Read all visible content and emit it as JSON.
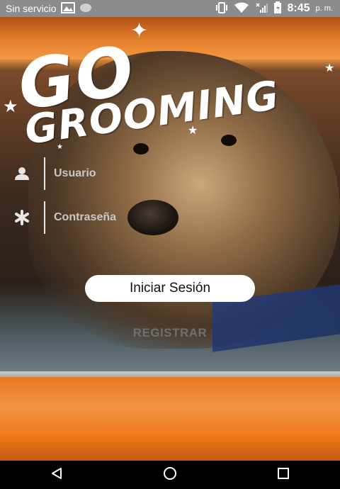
{
  "status_bar": {
    "carrier": "Sin servicio",
    "time": "8:45",
    "ampm": "p. m."
  },
  "logo": {
    "line1": "GO",
    "line2": "GROOMING"
  },
  "form": {
    "username_placeholder": "Usuario",
    "password_placeholder": "Contraseña",
    "login_label": "Iniciar Sesión",
    "register_label": "REGISTRAR"
  },
  "nav": {
    "back_icon": "back-triangle-icon",
    "home_icon": "home-circle-icon",
    "recents_icon": "recents-square-icon"
  },
  "colors": {
    "status_bar": "#8c8c8c",
    "car_orange": "#f0791c",
    "button_bg": "#ffffff",
    "register_text": "#6f6f6f"
  }
}
